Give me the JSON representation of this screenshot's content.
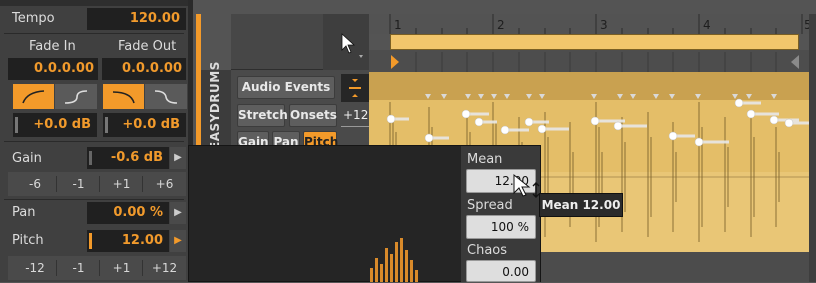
{
  "inspector": {
    "tempo": {
      "label": "Tempo",
      "value": "120.00"
    },
    "fade_in": {
      "label": "Fade In",
      "value": "0.0.0.00"
    },
    "fade_out": {
      "label": "Fade Out",
      "value": "0.0.0.00"
    },
    "fade_in_db": "+0.0 dB",
    "fade_out_db": "+0.0 dB",
    "gain": {
      "label": "Gain",
      "value": "-0.6 dB",
      "steps": [
        "-6",
        "-1",
        "+1",
        "+6"
      ]
    },
    "pan": {
      "label": "Pan",
      "value": "0.00 %"
    },
    "pitch": {
      "label": "Pitch",
      "value": "12.00",
      "steps": [
        "-12",
        "-1",
        "+1",
        "+12"
      ]
    }
  },
  "track": {
    "name": "EASYDRUMS",
    "audio_events_label": "Audio Events",
    "stretch_label": "Stretch",
    "onsets_label": "Onsets",
    "plus12_label": "+12",
    "expr_tabs": [
      "Gain",
      "Pan",
      "Pitch"
    ]
  },
  "timeline": {
    "bars": [
      "1",
      "2",
      "3",
      "4",
      "5"
    ]
  },
  "popup": {
    "mean": {
      "label": "Mean",
      "value": "12.00"
    },
    "spread": {
      "label": "Spread",
      "value": "100 %"
    },
    "chaos": {
      "label": "Chaos",
      "value": "0.00"
    }
  },
  "tooltip": "Mean 12.00",
  "colors": {
    "accent": "#f39a2a",
    "clip": "#e3bd66",
    "panel": "#3a3a3a",
    "value_text": "#f19a2c"
  }
}
